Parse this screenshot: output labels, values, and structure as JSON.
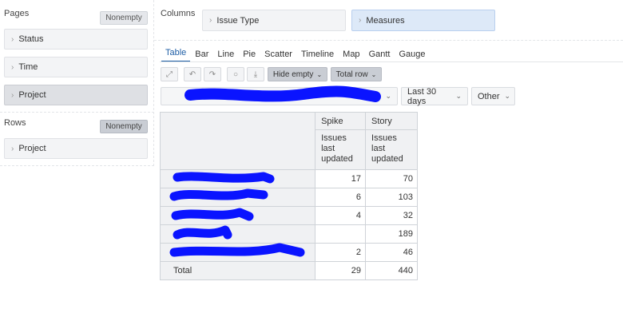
{
  "pages": {
    "label": "Pages",
    "nonempty_label": "Nonempty",
    "items": [
      {
        "label": "Status"
      },
      {
        "label": "Time"
      },
      {
        "label": "Project"
      }
    ]
  },
  "rows": {
    "label": "Rows",
    "nonempty_label": "Nonempty",
    "items": [
      {
        "label": "Project"
      }
    ]
  },
  "columns": {
    "label": "Columns",
    "items": [
      {
        "label": "Issue Type"
      },
      {
        "label": "Measures"
      }
    ]
  },
  "tabs": [
    {
      "label": "Table"
    },
    {
      "label": "Bar"
    },
    {
      "label": "Line"
    },
    {
      "label": "Pie"
    },
    {
      "label": "Scatter"
    },
    {
      "label": "Timeline"
    },
    {
      "label": "Map"
    },
    {
      "label": "Gantt"
    },
    {
      "label": "Gauge"
    }
  ],
  "toolbar": {
    "hide_empty_label": "Hide empty",
    "total_row_label": "Total row"
  },
  "filters": {
    "period_label": "Last 30 days",
    "other_label": "Other"
  },
  "table": {
    "col_headers": [
      "Spike",
      "Story"
    ],
    "measure_headers": [
      "Issues last updated",
      "Issues last updated"
    ],
    "rows": [
      {
        "spike": "17",
        "story": "70"
      },
      {
        "spike": "6",
        "story": "103"
      },
      {
        "spike": "4",
        "story": "32"
      },
      {
        "spike": "",
        "story": "189"
      },
      {
        "spike": "2",
        "story": "46"
      }
    ],
    "total": {
      "label": "Total",
      "spike": "29",
      "story": "440"
    }
  },
  "colors": {
    "accent": "#1f5fa6",
    "redaction": "#0a14ff"
  }
}
